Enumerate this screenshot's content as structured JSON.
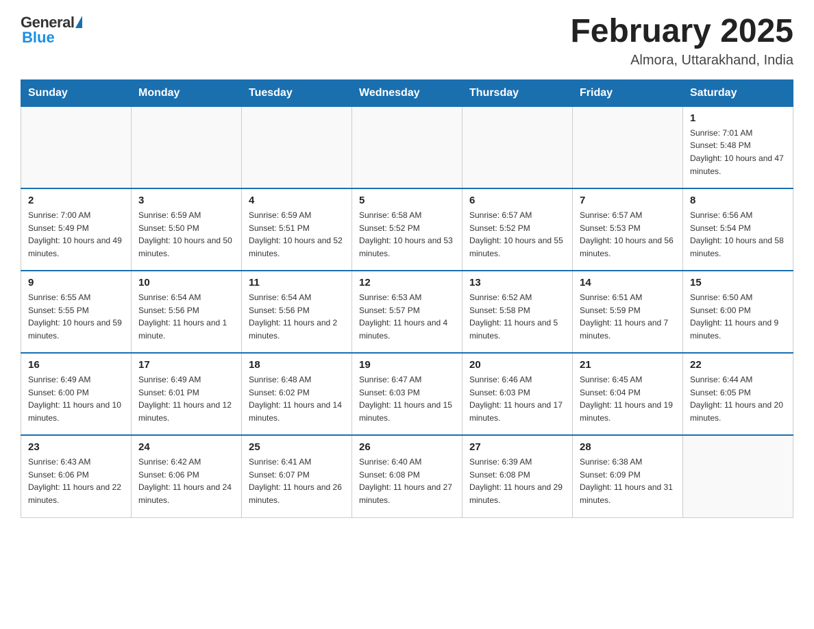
{
  "header": {
    "logo_general": "General",
    "logo_blue": "Blue",
    "month": "February 2025",
    "location": "Almora, Uttarakhand, India"
  },
  "weekdays": [
    "Sunday",
    "Monday",
    "Tuesday",
    "Wednesday",
    "Thursday",
    "Friday",
    "Saturday"
  ],
  "weeks": [
    [
      {
        "day": "",
        "sunrise": "",
        "sunset": "",
        "daylight": ""
      },
      {
        "day": "",
        "sunrise": "",
        "sunset": "",
        "daylight": ""
      },
      {
        "day": "",
        "sunrise": "",
        "sunset": "",
        "daylight": ""
      },
      {
        "day": "",
        "sunrise": "",
        "sunset": "",
        "daylight": ""
      },
      {
        "day": "",
        "sunrise": "",
        "sunset": "",
        "daylight": ""
      },
      {
        "day": "",
        "sunrise": "",
        "sunset": "",
        "daylight": ""
      },
      {
        "day": "1",
        "sunrise": "Sunrise: 7:01 AM",
        "sunset": "Sunset: 5:48 PM",
        "daylight": "Daylight: 10 hours and 47 minutes."
      }
    ],
    [
      {
        "day": "2",
        "sunrise": "Sunrise: 7:00 AM",
        "sunset": "Sunset: 5:49 PM",
        "daylight": "Daylight: 10 hours and 49 minutes."
      },
      {
        "day": "3",
        "sunrise": "Sunrise: 6:59 AM",
        "sunset": "Sunset: 5:50 PM",
        "daylight": "Daylight: 10 hours and 50 minutes."
      },
      {
        "day": "4",
        "sunrise": "Sunrise: 6:59 AM",
        "sunset": "Sunset: 5:51 PM",
        "daylight": "Daylight: 10 hours and 52 minutes."
      },
      {
        "day": "5",
        "sunrise": "Sunrise: 6:58 AM",
        "sunset": "Sunset: 5:52 PM",
        "daylight": "Daylight: 10 hours and 53 minutes."
      },
      {
        "day": "6",
        "sunrise": "Sunrise: 6:57 AM",
        "sunset": "Sunset: 5:52 PM",
        "daylight": "Daylight: 10 hours and 55 minutes."
      },
      {
        "day": "7",
        "sunrise": "Sunrise: 6:57 AM",
        "sunset": "Sunset: 5:53 PM",
        "daylight": "Daylight: 10 hours and 56 minutes."
      },
      {
        "day": "8",
        "sunrise": "Sunrise: 6:56 AM",
        "sunset": "Sunset: 5:54 PM",
        "daylight": "Daylight: 10 hours and 58 minutes."
      }
    ],
    [
      {
        "day": "9",
        "sunrise": "Sunrise: 6:55 AM",
        "sunset": "Sunset: 5:55 PM",
        "daylight": "Daylight: 10 hours and 59 minutes."
      },
      {
        "day": "10",
        "sunrise": "Sunrise: 6:54 AM",
        "sunset": "Sunset: 5:56 PM",
        "daylight": "Daylight: 11 hours and 1 minute."
      },
      {
        "day": "11",
        "sunrise": "Sunrise: 6:54 AM",
        "sunset": "Sunset: 5:56 PM",
        "daylight": "Daylight: 11 hours and 2 minutes."
      },
      {
        "day": "12",
        "sunrise": "Sunrise: 6:53 AM",
        "sunset": "Sunset: 5:57 PM",
        "daylight": "Daylight: 11 hours and 4 minutes."
      },
      {
        "day": "13",
        "sunrise": "Sunrise: 6:52 AM",
        "sunset": "Sunset: 5:58 PM",
        "daylight": "Daylight: 11 hours and 5 minutes."
      },
      {
        "day": "14",
        "sunrise": "Sunrise: 6:51 AM",
        "sunset": "Sunset: 5:59 PM",
        "daylight": "Daylight: 11 hours and 7 minutes."
      },
      {
        "day": "15",
        "sunrise": "Sunrise: 6:50 AM",
        "sunset": "Sunset: 6:00 PM",
        "daylight": "Daylight: 11 hours and 9 minutes."
      }
    ],
    [
      {
        "day": "16",
        "sunrise": "Sunrise: 6:49 AM",
        "sunset": "Sunset: 6:00 PM",
        "daylight": "Daylight: 11 hours and 10 minutes."
      },
      {
        "day": "17",
        "sunrise": "Sunrise: 6:49 AM",
        "sunset": "Sunset: 6:01 PM",
        "daylight": "Daylight: 11 hours and 12 minutes."
      },
      {
        "day": "18",
        "sunrise": "Sunrise: 6:48 AM",
        "sunset": "Sunset: 6:02 PM",
        "daylight": "Daylight: 11 hours and 14 minutes."
      },
      {
        "day": "19",
        "sunrise": "Sunrise: 6:47 AM",
        "sunset": "Sunset: 6:03 PM",
        "daylight": "Daylight: 11 hours and 15 minutes."
      },
      {
        "day": "20",
        "sunrise": "Sunrise: 6:46 AM",
        "sunset": "Sunset: 6:03 PM",
        "daylight": "Daylight: 11 hours and 17 minutes."
      },
      {
        "day": "21",
        "sunrise": "Sunrise: 6:45 AM",
        "sunset": "Sunset: 6:04 PM",
        "daylight": "Daylight: 11 hours and 19 minutes."
      },
      {
        "day": "22",
        "sunrise": "Sunrise: 6:44 AM",
        "sunset": "Sunset: 6:05 PM",
        "daylight": "Daylight: 11 hours and 20 minutes."
      }
    ],
    [
      {
        "day": "23",
        "sunrise": "Sunrise: 6:43 AM",
        "sunset": "Sunset: 6:06 PM",
        "daylight": "Daylight: 11 hours and 22 minutes."
      },
      {
        "day": "24",
        "sunrise": "Sunrise: 6:42 AM",
        "sunset": "Sunset: 6:06 PM",
        "daylight": "Daylight: 11 hours and 24 minutes."
      },
      {
        "day": "25",
        "sunrise": "Sunrise: 6:41 AM",
        "sunset": "Sunset: 6:07 PM",
        "daylight": "Daylight: 11 hours and 26 minutes."
      },
      {
        "day": "26",
        "sunrise": "Sunrise: 6:40 AM",
        "sunset": "Sunset: 6:08 PM",
        "daylight": "Daylight: 11 hours and 27 minutes."
      },
      {
        "day": "27",
        "sunrise": "Sunrise: 6:39 AM",
        "sunset": "Sunset: 6:08 PM",
        "daylight": "Daylight: 11 hours and 29 minutes."
      },
      {
        "day": "28",
        "sunrise": "Sunrise: 6:38 AM",
        "sunset": "Sunset: 6:09 PM",
        "daylight": "Daylight: 11 hours and 31 minutes."
      },
      {
        "day": "",
        "sunrise": "",
        "sunset": "",
        "daylight": ""
      }
    ]
  ]
}
